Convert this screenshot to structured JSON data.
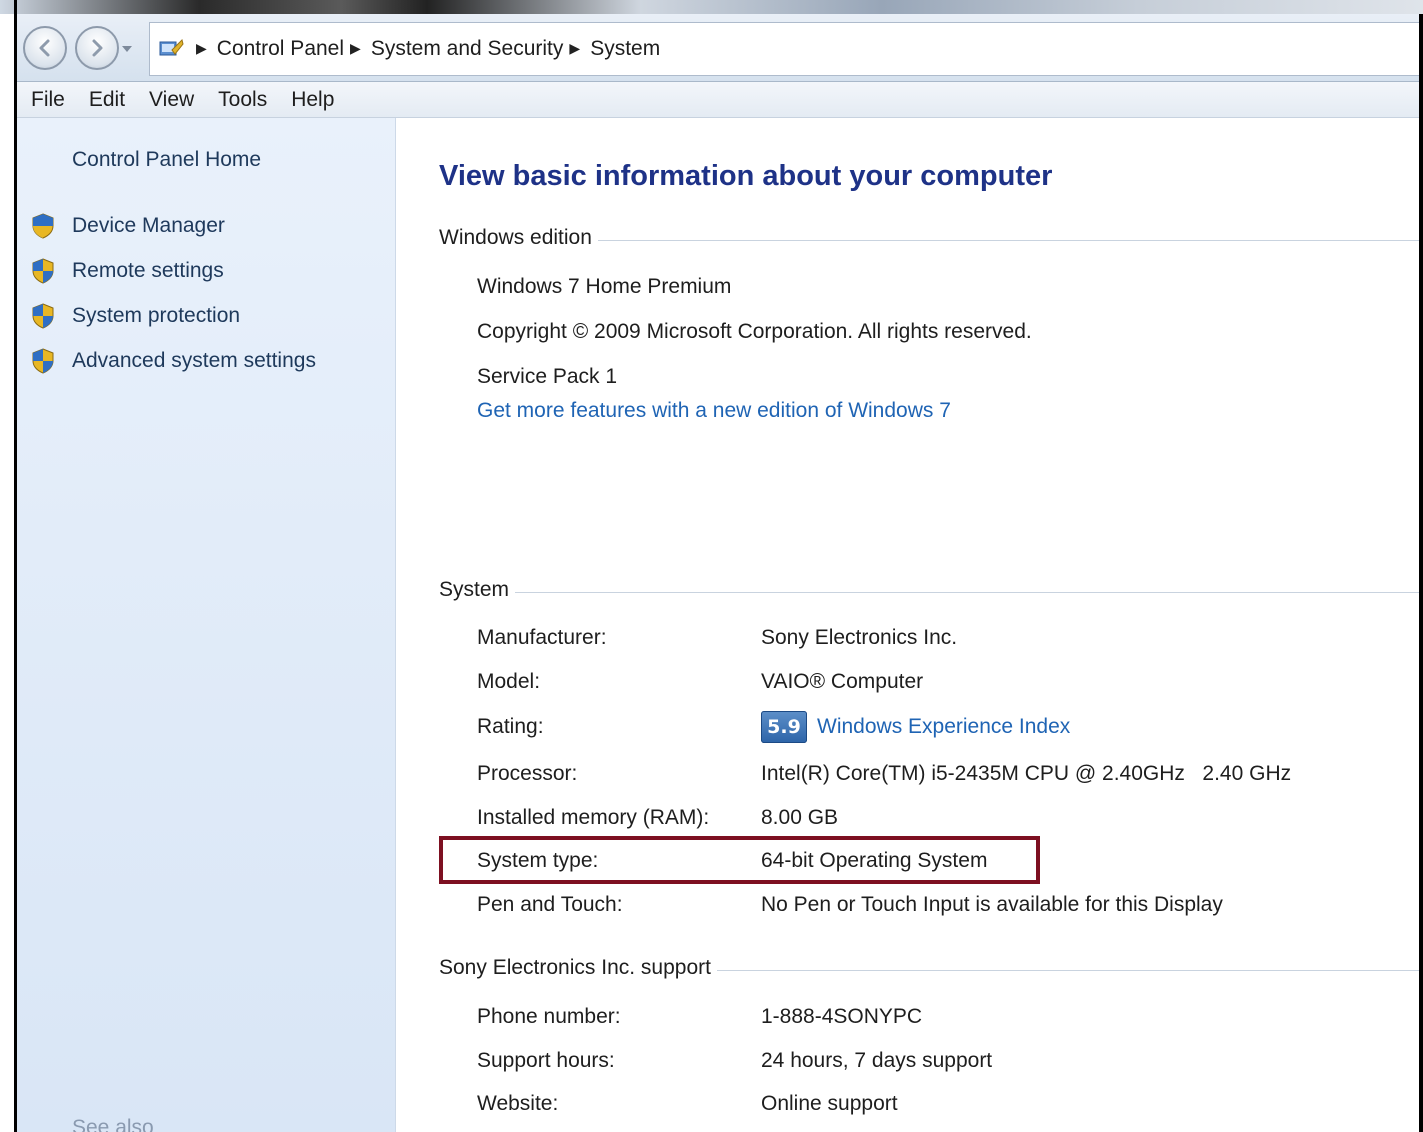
{
  "breadcrumb": [
    "Control Panel",
    "System and Security",
    "System"
  ],
  "menu": [
    "File",
    "Edit",
    "View",
    "Tools",
    "Help"
  ],
  "sidebar": {
    "home": "Control Panel Home",
    "items": [
      {
        "label": "Device Manager"
      },
      {
        "label": "Remote settings"
      },
      {
        "label": "System protection"
      },
      {
        "label": "Advanced system settings"
      }
    ],
    "see_also": "See also"
  },
  "main": {
    "title": "View basic information about your computer",
    "edition": {
      "heading": "Windows edition",
      "name": "Windows 7 Home Premium",
      "copyright": "Copyright © 2009 Microsoft Corporation.  All rights reserved.",
      "service_pack": "Service Pack 1",
      "upgrade_link": "Get more features with a new edition of Windows 7"
    },
    "system": {
      "heading": "System",
      "rows": [
        {
          "label": "Manufacturer:",
          "value": "Sony Electronics Inc."
        },
        {
          "label": "Model:",
          "value": "VAIO® Computer"
        },
        {
          "label": "Rating:",
          "badge": "5.9",
          "value": "Windows Experience Index"
        },
        {
          "label": "Processor:",
          "value": "Intel(R) Core(TM) i5-2435M CPU @ 2.40GHz   2.40 GHz"
        },
        {
          "label": "Installed memory (RAM):",
          "value": "8.00 GB"
        },
        {
          "label": "System type:",
          "value": "64-bit Operating System"
        },
        {
          "label": "Pen and Touch:",
          "value": "No Pen or Touch Input is available for this Display"
        }
      ]
    },
    "support": {
      "heading": "Sony Electronics Inc. support",
      "rows": [
        {
          "label": "Phone number:",
          "value": "1-888-4SONYPC"
        },
        {
          "label": "Support hours:",
          "value": "24 hours, 7 days support"
        },
        {
          "label": "Website:",
          "value": "Online support"
        }
      ]
    }
  },
  "colors": {
    "link": "#1f64b4",
    "title": "#1e3287",
    "sidebar_bg": "#dfeaf8",
    "highlight_border": "#7d1021"
  }
}
